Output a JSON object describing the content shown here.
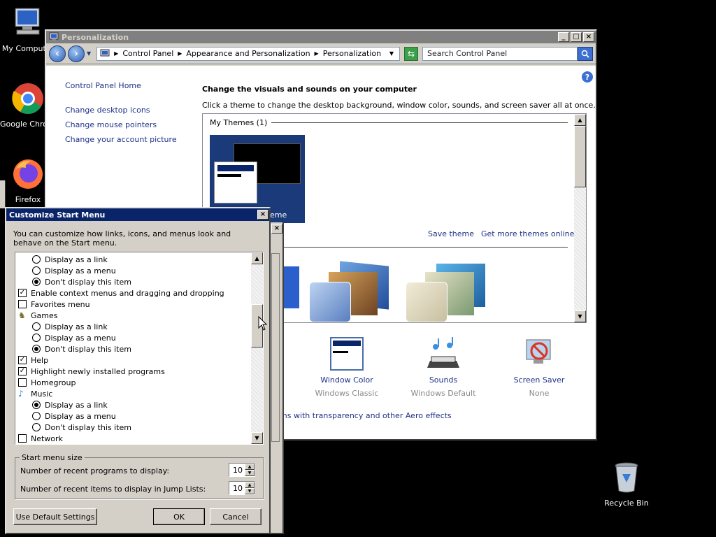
{
  "desktop": {
    "icons": [
      {
        "label": "My Computer"
      },
      {
        "label": "Google Chrome"
      },
      {
        "label": "Firefox"
      },
      {
        "label": "Recycle Bin"
      }
    ]
  },
  "personalization": {
    "title": "Personalization",
    "breadcrumb": [
      "Control Panel",
      "Appearance and Personalization",
      "Personalization"
    ],
    "search_placeholder": "Search Control Panel",
    "sidebar": {
      "home": "Control Panel Home",
      "links": [
        "Change desktop icons",
        "Change mouse pointers",
        "Change your account picture"
      ]
    },
    "heading": "Change the visuals and sounds on your computer",
    "subheading": "Click a theme to change the desktop background, window color, sounds, and screen saver all at once.",
    "my_themes_label": "My Themes (1)",
    "theme_name_fragment": "eme",
    "save_theme": "Save theme",
    "get_more_themes": "Get more themes online",
    "settings": [
      {
        "title": "Window Color",
        "value": "Windows Classic"
      },
      {
        "title": "Sounds",
        "value": "Windows Default"
      },
      {
        "title": "Screen Saver",
        "value": "None"
      }
    ],
    "aero_link_fragment": "ms with transparency and other Aero effects"
  },
  "customize_start_menu": {
    "title": "Customize Start Menu",
    "description": "You can customize how links, icons, and menus look and behave on the Start menu.",
    "items": [
      {
        "type": "radio",
        "label": "Display as a link",
        "checked": false
      },
      {
        "type": "radio",
        "label": "Display as a menu",
        "checked": false
      },
      {
        "type": "radio",
        "label": "Don't display this item",
        "checked": true
      },
      {
        "type": "check",
        "label": "Enable context menus and dragging and dropping",
        "checked": true
      },
      {
        "type": "check",
        "label": "Favorites menu",
        "checked": false
      },
      {
        "type": "folder",
        "label": "Games",
        "icon": "games-icon"
      },
      {
        "type": "radio",
        "label": "Display as a link",
        "checked": false
      },
      {
        "type": "radio",
        "label": "Display as a menu",
        "checked": false
      },
      {
        "type": "radio",
        "label": "Don't display this item",
        "checked": true
      },
      {
        "type": "check",
        "label": "Help",
        "checked": true
      },
      {
        "type": "check",
        "label": "Highlight newly installed programs",
        "checked": true
      },
      {
        "type": "check",
        "label": "Homegroup",
        "checked": false
      },
      {
        "type": "folder",
        "label": "Music",
        "icon": "music-icon"
      },
      {
        "type": "radio",
        "label": "Display as a link",
        "checked": true
      },
      {
        "type": "radio",
        "label": "Display as a menu",
        "checked": false
      },
      {
        "type": "radio",
        "label": "Don't display this item",
        "checked": false
      },
      {
        "type": "check",
        "label": "Network",
        "checked": false
      }
    ],
    "start_menu_size_label": "Start menu size",
    "recent_programs_label": "Number of recent programs to display:",
    "recent_programs_value": "10",
    "recent_items_label": "Number of recent items to display in Jump Lists:",
    "recent_items_value": "10",
    "use_default_label": "Use Default Settings",
    "ok_label": "OK",
    "cancel_label": "Cancel"
  }
}
